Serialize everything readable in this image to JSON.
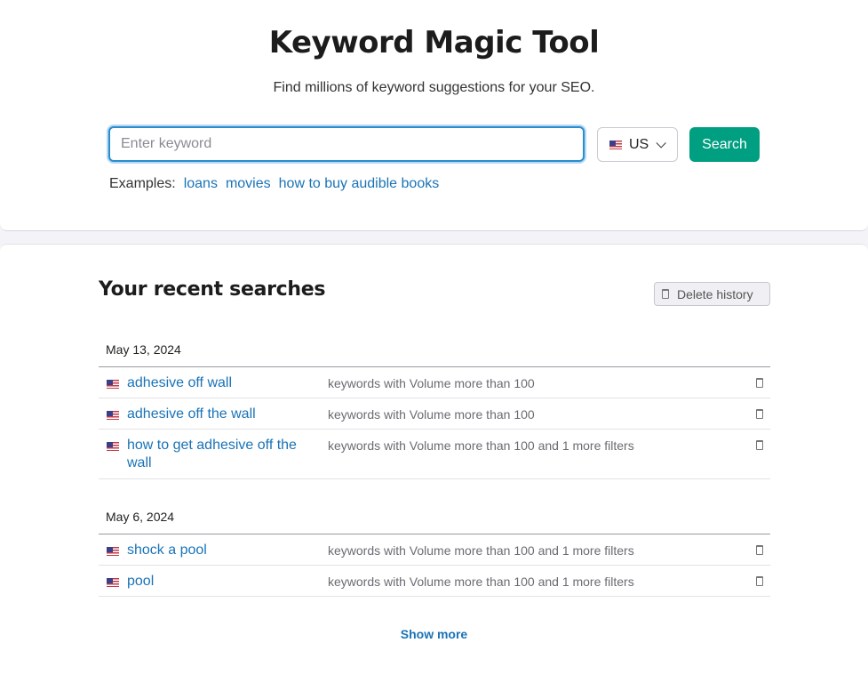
{
  "header": {
    "title": "Keyword Magic Tool",
    "subtitle": "Find millions of keyword suggestions for your SEO."
  },
  "search": {
    "placeholder": "Enter keyword",
    "value": "",
    "database": {
      "flag_icon": "us-flag-icon",
      "label": "US"
    },
    "button_label": "Search",
    "button_color": "#009f81"
  },
  "examples": {
    "label": "Examples:",
    "items": [
      "loans",
      "movies",
      "how to buy audible books"
    ]
  },
  "recent": {
    "title": "Your recent searches",
    "delete_history_label": "Delete history",
    "groups": [
      {
        "date": "May 13, 2024",
        "items": [
          {
            "keyword": "adhesive off wall",
            "filter": "keywords with Volume more than 100"
          },
          {
            "keyword": "adhesive off the wall",
            "filter": "keywords with Volume more than 100"
          },
          {
            "keyword": "how to get adhesive off the wall",
            "filter": "keywords with Volume more than 100 and 1 more filters"
          }
        ]
      },
      {
        "date": "May 6, 2024",
        "items": [
          {
            "keyword": "shock a pool",
            "filter": "keywords with Volume more than 100 and 1 more filters"
          },
          {
            "keyword": "pool",
            "filter": "keywords with Volume more than 100 and 1 more filters"
          }
        ]
      }
    ],
    "show_more_label": "Show more"
  },
  "colors": {
    "link": "#1a73b6",
    "accent": "#009f81",
    "focus": "#2b8ccf"
  }
}
